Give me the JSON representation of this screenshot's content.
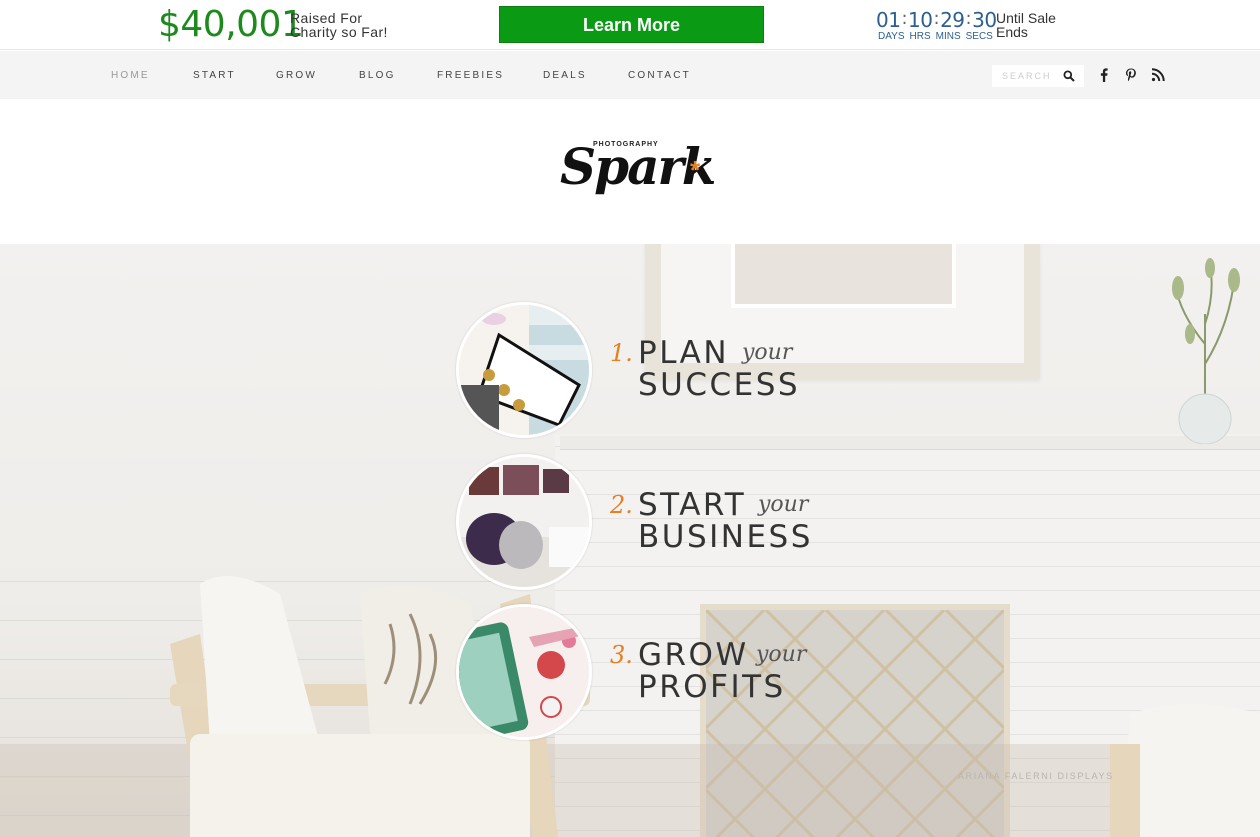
{
  "promo": {
    "amount": "$40,001",
    "raised_line1": "Raised For",
    "raised_line2": "Charity so Far!",
    "cta_label": "Learn More",
    "countdown": {
      "days": "01",
      "hrs": "10",
      "mins": "29",
      "secs": "30"
    },
    "units": {
      "days": "DAYS",
      "hrs": "HRS",
      "mins": "MINS",
      "secs": "SECS"
    },
    "until_line1": "Until Sale",
    "until_line2": "Ends",
    "colors": {
      "amount": "#1c8a1c",
      "cta_bg": "#0a9a14",
      "timer": "#2d5f8f"
    }
  },
  "nav": {
    "items": [
      "HOME",
      "START",
      "GROW",
      "BLOG",
      "FREEBIES",
      "DEALS",
      "CONTACT"
    ],
    "search_placeholder": "SEARCH",
    "social": [
      "facebook-icon",
      "pinterest-icon",
      "rss-icon"
    ]
  },
  "logo": {
    "small": "PHOTOGRAPHY",
    "script": "Spark",
    "star": "*",
    "accent": "#e67e22"
  },
  "steps": [
    {
      "num": "1.",
      "word1": "PLAN",
      "your": "your",
      "word2": "SUCCESS"
    },
    {
      "num": "2.",
      "word1": "START",
      "your": "your",
      "word2": "BUSINESS"
    },
    {
      "num": "3.",
      "word1": "GROW",
      "your": "your",
      "word2": "PROFITS"
    }
  ],
  "hero": {
    "credit": "ARIANA FALERNI DISPLAYS"
  }
}
